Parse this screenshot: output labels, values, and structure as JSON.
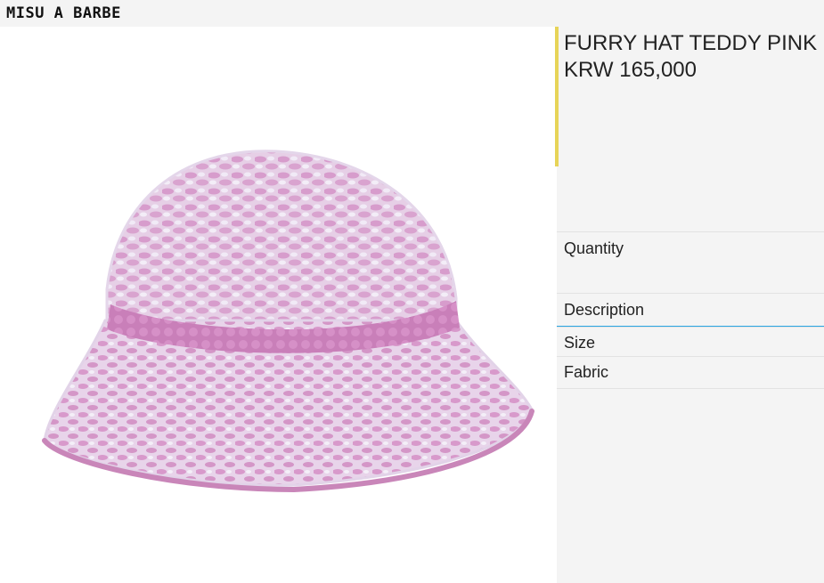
{
  "brand": {
    "logo_text": "MISU A BARBE"
  },
  "product": {
    "image_alt": "pink furry knit bucket hat",
    "title": "FURRY HAT TEDDY PINK",
    "price": "KRW 165,000"
  },
  "options": {
    "quantity_label": "Quantity"
  },
  "accordion": {
    "description_label": "Description",
    "size_label": "Size",
    "fabric_label": "Fabric"
  },
  "colors": {
    "accent": "#e7d458",
    "active_underline": "#2aa6e3",
    "hat_pink": "#d59ac6",
    "hat_light": "#ece3f2"
  }
}
